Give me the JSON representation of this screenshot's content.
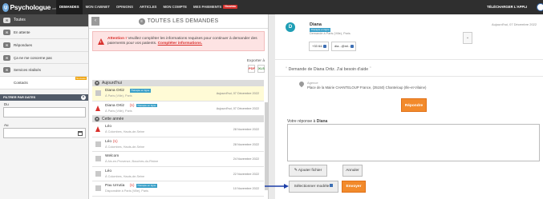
{
  "topbar": {
    "logo_text": "Psychologue",
    "logo_tld": ".net",
    "nav": [
      {
        "label": "DEMANDES"
      },
      {
        "label": "MON CABINET"
      },
      {
        "label": "OPINIONS"
      },
      {
        "label": "ARTICLES"
      },
      {
        "label": "MON COMPTE"
      },
      {
        "label": "MES PAIEMENTS",
        "badge": "Nouveau"
      }
    ],
    "download_app": "TÉLÉCHARGER L'APPLI"
  },
  "folders": [
    {
      "label": "Toutes",
      "icon": "inbox-icon"
    },
    {
      "label": "En attente",
      "icon": "inbox-icon"
    },
    {
      "label": "Répondues",
      "icon": "inbox-icon"
    },
    {
      "label": "Ça ne me concerne pas",
      "icon": "inbox-icon"
    },
    {
      "label": "Services réalisés",
      "icon": "inbox-icon"
    },
    {
      "label": "Contacts",
      "badge": "Nouveau"
    }
  ],
  "filter": {
    "title": "FILTRER PAR DATES",
    "from_label": "Du",
    "to_label": "Au"
  },
  "list_header": {
    "title": "TOUTES LES DEMANDES"
  },
  "alert": {
    "strong": "Attention !",
    "text": " Veuillez compléter les informations requises pour continuer à demander des paiements pour vos patients.",
    "link": "Compléter informations."
  },
  "export": {
    "label": "Exporter à",
    "pdf": "PDF",
    "xls": "XLS"
  },
  "groups": [
    {
      "label": "Aujourd'hui",
      "rows": [
        {
          "name": "Diana Ortiz",
          "badge": "Thérapie en ligne",
          "sub": "À Paris (Ville), Paris",
          "date": "Aujourd'hui, 07 Décembre 2022",
          "icon": "gray",
          "selected": true
        },
        {
          "name": "Diana Ortiz",
          "count": "(1)",
          "badge": "Thérapie en ligne",
          "sub": "À Paris (Ville), Paris",
          "date": "Aujourd'hui, 07 Décembre 2022",
          "icon": "red",
          "selected": false
        }
      ]
    },
    {
      "label": "Cette année",
      "rows": [
        {
          "name": "Léo",
          "sub": "À Colombes, Hauts-de-Seine",
          "date": "28 Novembre 2022",
          "icon": "red",
          "selected": false
        },
        {
          "name": "Léo",
          "count": "(1)",
          "sub": "À Colombes, Hauts-de-Seine",
          "date": "28 Novembre 2022",
          "icon": "gray",
          "selected": false
        },
        {
          "name": "Welcom",
          "sub": "À Aix-en-Provence, Bouches-du-Rhône",
          "date": "24 Novembre 2022",
          "icon": "gray",
          "selected": false
        },
        {
          "name": "Léo",
          "sub": "À Colombes, Hauts-de-Seine",
          "date": "22 Novembre 2022",
          "icon": "gray",
          "selected": false
        },
        {
          "name": "Pau Urrutia",
          "count": "(1)",
          "badge": "Thérapie en ligne",
          "sub": "Disponsible à Paris (Ville), Paris",
          "date": "10 Novembre 2022",
          "icon": "gray",
          "selected": false
        }
      ]
    }
  ],
  "detail": {
    "avatar_letter": "D",
    "name": "Diana",
    "badge": "Thérapie en ligne",
    "location": "Demande à Paris (Ville), Paris",
    "date": "Aujourd'hui, 07 Décembre 2022",
    "phone": "+33 64...",
    "email": "dia...@ml...",
    "quote": "Demande de Diana Ortiz. J'ai besoin d'aide",
    "agency_title": "Agence",
    "agency_address": "Place de la Mairie CHANTELOUP France, (35150) Chanteloup (Ille-et-Vilaine)",
    "reply_button": "Répondre",
    "reply_label_prefix": "Votre réponse à ",
    "reply_label_name": "Diana",
    "reply_value": "",
    "attach_button": "Ajouter fichier",
    "cancel_button": "Annuler",
    "template_button": "Sélectionner modèle",
    "send_button": "Envoyer"
  },
  "colors": {
    "topbar": "#2f2f2f",
    "accent_orange": "#f28a2b",
    "alert_red": "#d9302c",
    "badge_blue": "#3aa0c8",
    "avatar_teal": "#1f9eb5",
    "arrow_blue": "#1d3fa8"
  }
}
